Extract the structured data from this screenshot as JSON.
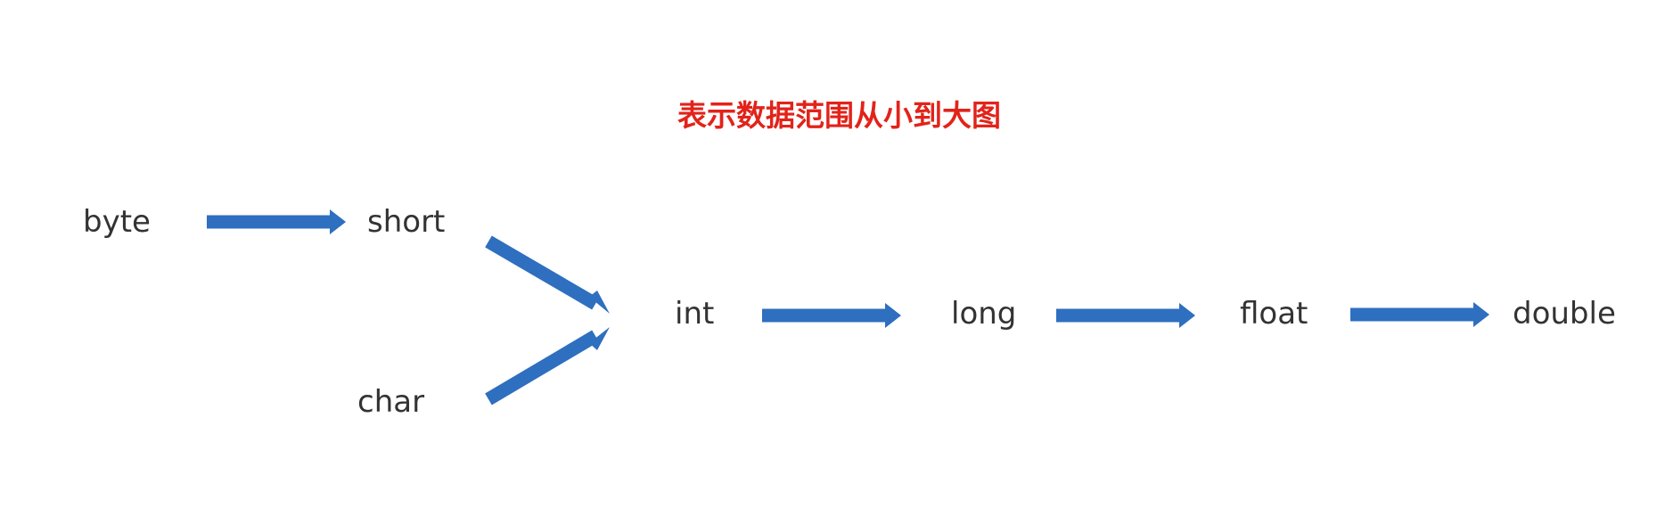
{
  "title": "表示数据范围从小到大图",
  "colors": {
    "title": "#e2231a",
    "arrow": "#2e6fbf",
    "text": "#333333"
  },
  "nodes": {
    "byte": "byte",
    "short": "short",
    "char": "char",
    "int": "int",
    "long": "long",
    "float": "float",
    "double": "double"
  },
  "edges": [
    {
      "from": "byte",
      "to": "short"
    },
    {
      "from": "short",
      "to": "int"
    },
    {
      "from": "char",
      "to": "int"
    },
    {
      "from": "int",
      "to": "long"
    },
    {
      "from": "long",
      "to": "float"
    },
    {
      "from": "float",
      "to": "double"
    }
  ]
}
